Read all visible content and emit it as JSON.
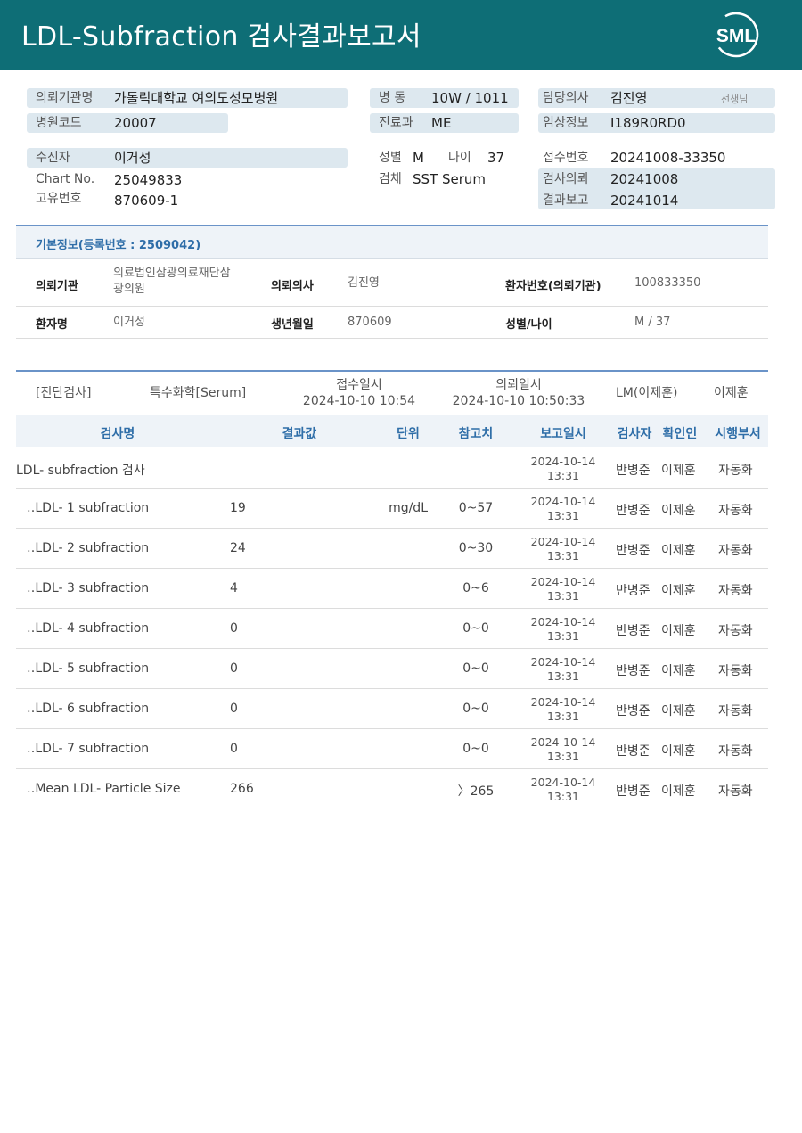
{
  "header": {
    "title": "LDL-Subfraction 검사결과보고서",
    "logo_text": "SML"
  },
  "patient_info": {
    "institution_label": "의뢰기관명",
    "institution": "가톨릭대학교 여의도성모병원",
    "hospital_code_label": "병원코드",
    "hospital_code": "20007",
    "ward_label": "병 동",
    "ward": "10W / 1011",
    "dept_label": "진료과",
    "dept": "ME",
    "doctor_label": "담당의사",
    "doctor": "김진영",
    "doctor_suffix": "선생님",
    "clinical_label": "임상정보",
    "clinical": "I189R0RD0",
    "patient_label": "수진자",
    "patient": "이거성",
    "chart_label": "Chart No.",
    "chart_no": "25049833",
    "unique_label": "고유번호",
    "unique_no": "870609-1",
    "sex_label": "성별",
    "sex": "M",
    "age_label": "나이",
    "age": "37",
    "specimen_label": "검체",
    "specimen": "SST Serum",
    "receipt_label": "접수번호",
    "receipt_no": "20241008-33350",
    "request_label": "검사의뢰",
    "request_date": "20241008",
    "report_label": "결과보고",
    "report_date": "20241014"
  },
  "basic_info": {
    "title": "기본정보(등록번호 : 2509042)",
    "institution_label": "의뢰기관",
    "institution_line1": "의료법인삼광의료재단삼",
    "institution_line2": "광의원",
    "doctor_label": "의뢰의사",
    "doctor": "김진영",
    "patient_no_label": "환자번호(의뢰기관)",
    "patient_no": "100833350",
    "name_label": "환자명",
    "name": "이거성",
    "birth_label": "생년월일",
    "birth": "870609",
    "sexage_label": "성별/나이",
    "sexage": "M / 37"
  },
  "diagnosis": {
    "category": "[진단검사]",
    "type": "특수화학[Serum]",
    "receipt_label": "접수일시",
    "receipt_time": "2024-10-10 10:54",
    "request_label": "의뢰일시",
    "request_time": "2024-10-10 10:50:33",
    "lm": "LM(이제훈)",
    "person": "이제훈"
  },
  "table": {
    "headers": {
      "name": "검사명",
      "result": "결과값",
      "unit": "단위",
      "ref": "참고치",
      "date": "보고일시",
      "tester": "검사자",
      "confirmer": "확인인",
      "dept": "시행부서"
    },
    "rows": [
      {
        "name": "LDL- subfraction 검사",
        "result": "",
        "unit": "",
        "ref": "",
        "date1": "2024-10-14",
        "date2": "13:31",
        "tester": "반병준",
        "confirmer": "이제훈",
        "dept": "자동화"
      },
      {
        "name": "‥LDL- 1 subfraction",
        "result": "19",
        "unit": "mg/dL",
        "ref": "0~57",
        "date1": "2024-10-14",
        "date2": "13:31",
        "tester": "반병준",
        "confirmer": "이제훈",
        "dept": "자동화"
      },
      {
        "name": "‥LDL- 2 subfraction",
        "result": "24",
        "unit": "",
        "ref": "0~30",
        "date1": "2024-10-14",
        "date2": "13:31",
        "tester": "반병준",
        "confirmer": "이제훈",
        "dept": "자동화"
      },
      {
        "name": "‥LDL- 3 subfraction",
        "result": "4",
        "unit": "",
        "ref": "0~6",
        "date1": "2024-10-14",
        "date2": "13:31",
        "tester": "반병준",
        "confirmer": "이제훈",
        "dept": "자동화"
      },
      {
        "name": "‥LDL- 4 subfraction",
        "result": "0",
        "unit": "",
        "ref": "0~0",
        "date1": "2024-10-14",
        "date2": "13:31",
        "tester": "반병준",
        "confirmer": "이제훈",
        "dept": "자동화"
      },
      {
        "name": "‥LDL- 5 subfraction",
        "result": "0",
        "unit": "",
        "ref": "0~0",
        "date1": "2024-10-14",
        "date2": "13:31",
        "tester": "반병준",
        "confirmer": "이제훈",
        "dept": "자동화"
      },
      {
        "name": "‥LDL- 6 subfraction",
        "result": "0",
        "unit": "",
        "ref": "0~0",
        "date1": "2024-10-14",
        "date2": "13:31",
        "tester": "반병준",
        "confirmer": "이제훈",
        "dept": "자동화"
      },
      {
        "name": "‥LDL- 7 subfraction",
        "result": "0",
        "unit": "",
        "ref": "0~0",
        "date1": "2024-10-14",
        "date2": "13:31",
        "tester": "반병준",
        "confirmer": "이제훈",
        "dept": "자동화"
      },
      {
        "name": "‥Mean LDL- Particle Size",
        "result": "266",
        "unit": "",
        "ref": "〉265",
        "date1": "2024-10-14",
        "date2": "13:31",
        "tester": "반병준",
        "confirmer": "이제훈",
        "dept": "자동화"
      }
    ]
  },
  "colors": {
    "header_bg": "#0e6e76",
    "pill_bg": "#dde8ef",
    "section_blue": "#2f6ea8"
  }
}
